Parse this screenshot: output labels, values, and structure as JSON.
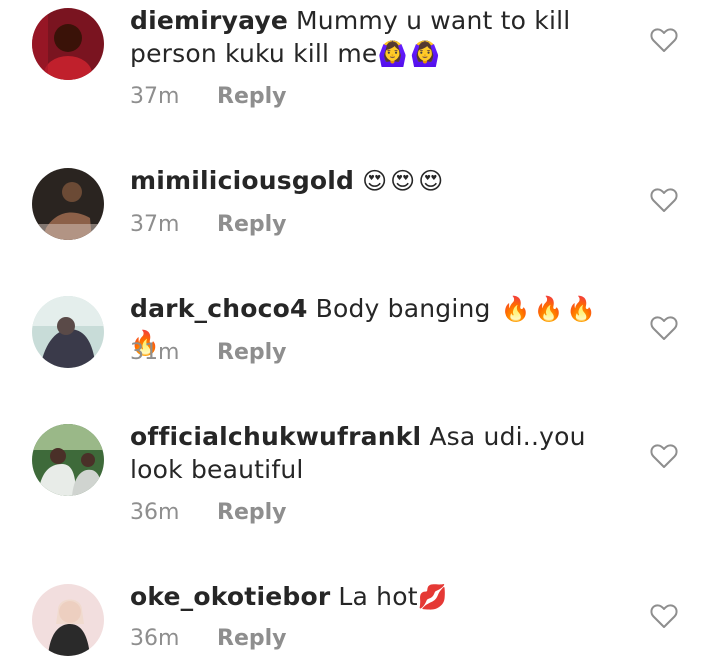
{
  "reply_label": "Reply",
  "comments": [
    {
      "username": "diemiryaye",
      "text": "Mummy u want to kill person kuku kill me",
      "emoji": "🙆‍♀️🙆‍♀️",
      "time": "37m"
    },
    {
      "username": "mimiliciousgold",
      "text": "",
      "emoji": "😍😍😍",
      "time": "37m"
    },
    {
      "username": "dark_choco4",
      "text": "Body banging",
      "emoji": "🔥🔥🔥🔥",
      "time": "31m"
    },
    {
      "username": "officialchukwufrankl",
      "text": "Asa udi..you look beautiful",
      "emoji": "",
      "time": "36m"
    },
    {
      "username": "oke_okotiebor",
      "text": "La hot",
      "emoji": "💋",
      "time": "36m"
    }
  ]
}
